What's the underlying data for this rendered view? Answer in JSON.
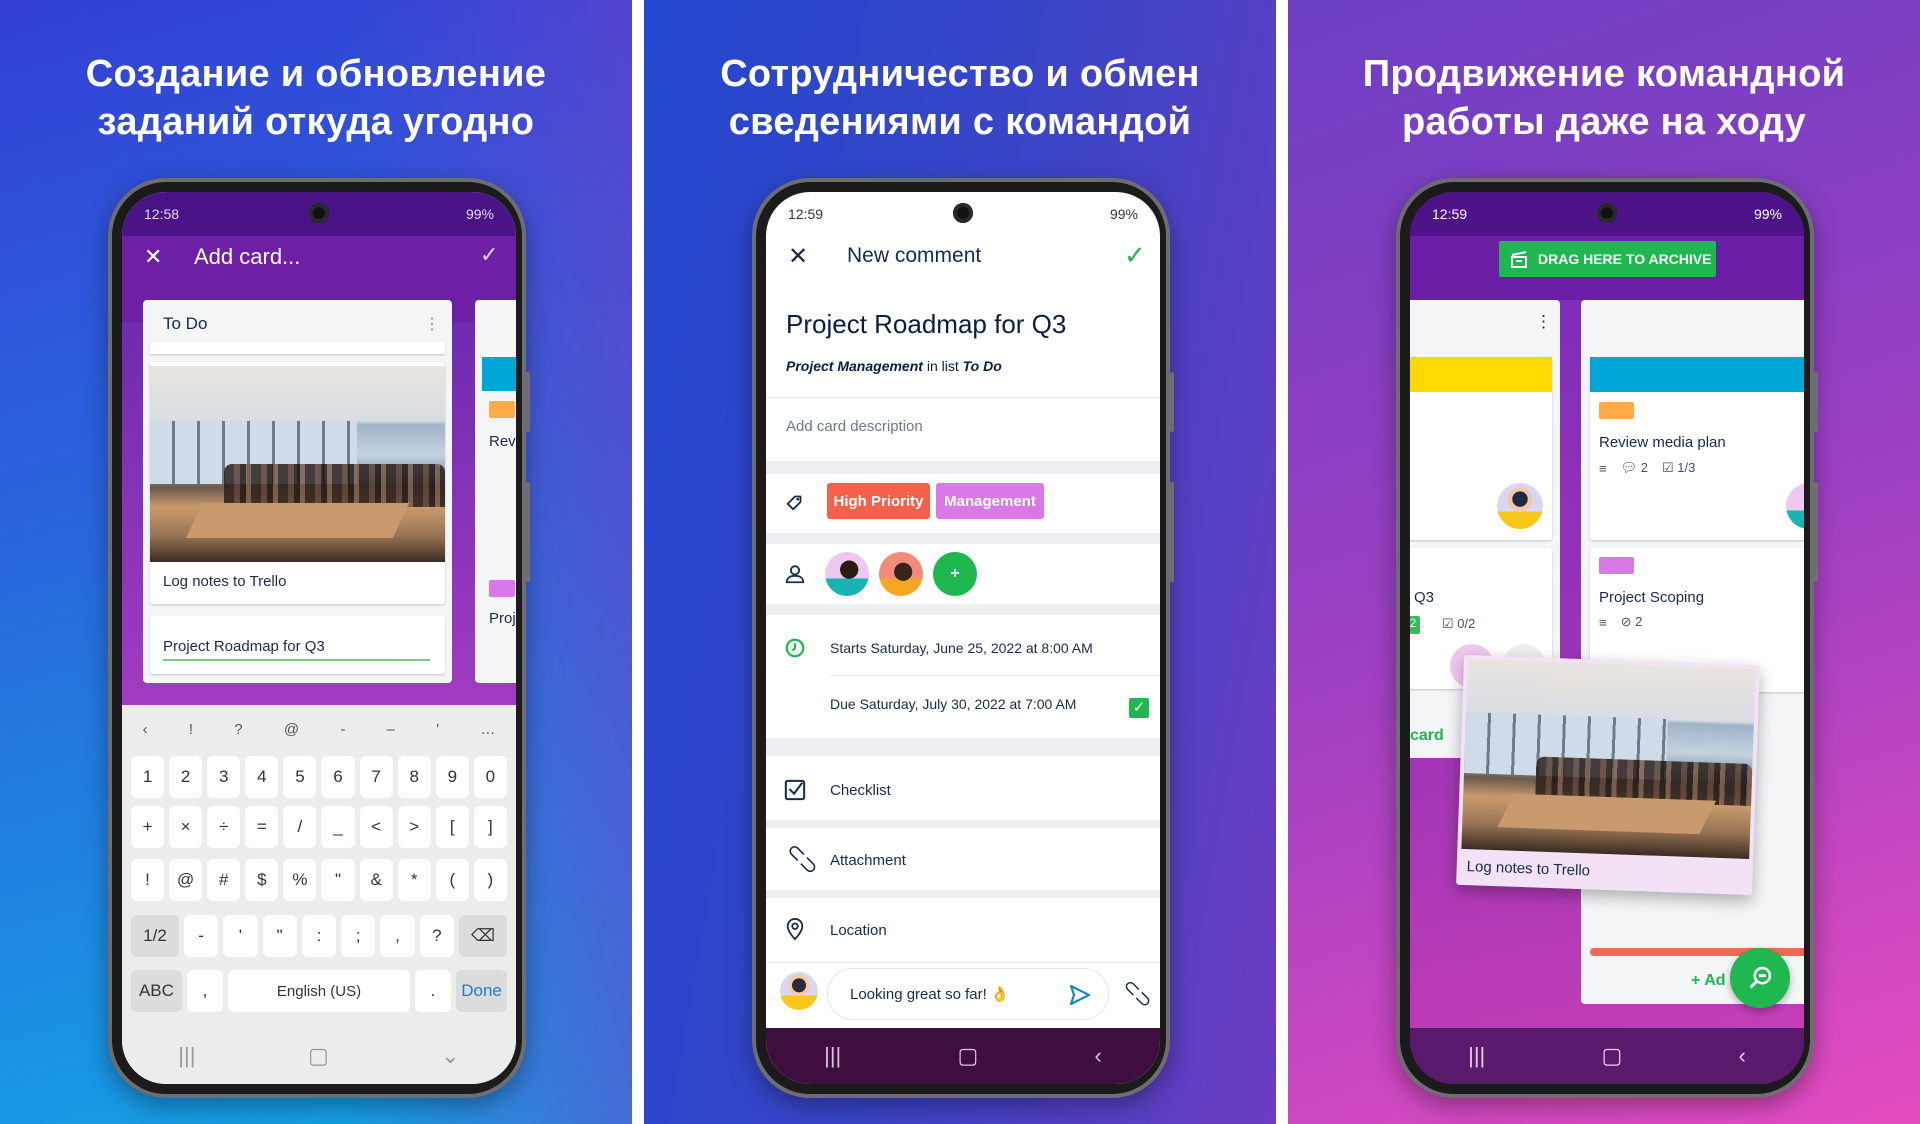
{
  "panels": [
    {
      "headline": [
        "Создание и обновление",
        "заданий откуда угодно"
      ]
    },
    {
      "headline": [
        "Сотрудничество и обмен",
        "сведениями с командой"
      ]
    },
    {
      "headline": [
        "Продвижение командной",
        "работы даже на ходу"
      ]
    }
  ],
  "phone1": {
    "status_time": "12:58",
    "status_battery": "99%",
    "header_title": "Add card...",
    "list_title": "To Do",
    "card_photo_caption": "Log notes to Trello",
    "new_card_input": "Project Roadmap for Q3",
    "peek_cards": [
      "Revi",
      "Proj"
    ],
    "keyboard": {
      "suggestions": [
        "‹",
        "!",
        "?",
        "@",
        "-",
        "–",
        "'",
        "…"
      ],
      "rows": [
        [
          "1",
          "2",
          "3",
          "4",
          "5",
          "6",
          "7",
          "8",
          "9",
          "0"
        ],
        [
          "+",
          "×",
          "÷",
          "=",
          "/",
          "_",
          "<",
          ">",
          "[",
          "]"
        ],
        [
          "!",
          "@",
          "#",
          "$",
          "%",
          "\"",
          "&",
          "*",
          "(",
          ")"
        ],
        [
          "1/2",
          "-",
          "'",
          "\"",
          ":",
          ";",
          ",",
          "?",
          "⌫"
        ],
        [
          "ABC",
          ",",
          "English (US)",
          ".",
          "Done"
        ]
      ]
    }
  },
  "phone2": {
    "status_time": "12:59",
    "status_battery": "99%",
    "header_title": "New comment",
    "card_title": "Project Roadmap for Q3",
    "board_name": "Project Management",
    "in_list_text": "in list",
    "list_name": "To Do",
    "description_placeholder": "Add card description",
    "labels": [
      {
        "text": "High Priority",
        "color": "#f5604a"
      },
      {
        "text": "Management",
        "color": "#d978e6"
      }
    ],
    "add_member_label": "+",
    "start_date": "Starts Saturday, June 25, 2022 at 8:00 AM",
    "due_date": "Due Saturday, July 30, 2022 at 7:00 AM",
    "due_complete": true,
    "actions": [
      "Checklist",
      "Attachment",
      "Location"
    ],
    "comment_value": "Looking great so far! 👌"
  },
  "phone3": {
    "status_time": "12:59",
    "status_battery": "99%",
    "archive_label": "DRAG HERE TO ARCHIVE",
    "left_card_title": "Q3",
    "left_card_badge_green": "2",
    "left_card_checklist": "0/2",
    "add_card_partial": "card",
    "review_card": {
      "title": "Review media plan",
      "comments": "2",
      "checklist": "1/3"
    },
    "scoping_card": {
      "title": "Project Scoping",
      "attachments": "2"
    },
    "dragged_card_caption": "Log notes to Trello",
    "add_partial": "+ Ad"
  },
  "colors": {
    "trello_green": "#1fb74f",
    "purple_header": "#6a1fa6",
    "text_dark": "#172b4d",
    "cover_yellow": "#ffd900",
    "cover_blue": "#00a6d6",
    "label_orange": "#ffab4a",
    "label_pink": "#d978e6",
    "bar_red": "#f26a5a"
  }
}
